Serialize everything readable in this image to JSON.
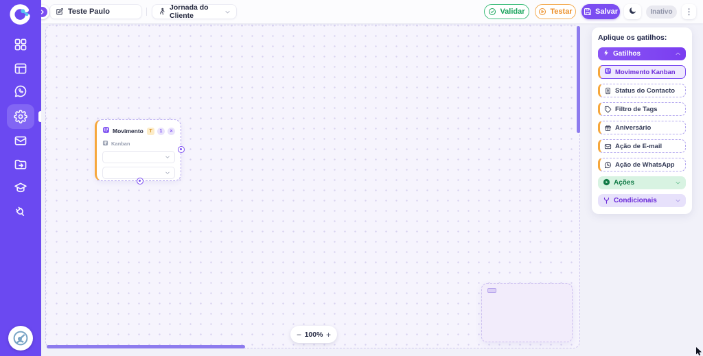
{
  "colors": {
    "sidebar": "#6b49f1",
    "accent_purple": "#7b4df1",
    "accent_orange": "#f6a73c",
    "accent_green": "#17a35b",
    "canvas_bg": "#f6f4fd"
  },
  "sidebar": {
    "icons": [
      "dashboard-icon",
      "board-icon",
      "whatsapp-icon",
      "settings-icon",
      "inbox-icon",
      "folder-import-icon",
      "education-icon",
      "integrations-icon"
    ],
    "active_icon": "settings-icon"
  },
  "header": {
    "flow_name": {
      "value": "Teste Paulo"
    },
    "journey_select": {
      "value": "Jornada do Cliente"
    },
    "validate_label": "Validar",
    "test_label": "Testar",
    "save_label": "Salvar",
    "status_label": "Inativo",
    "kebab": "⋮"
  },
  "canvas": {
    "node": {
      "title": "Movimento ...",
      "badge_type": "T",
      "badge_count": "1",
      "badge_close": "×",
      "subtitle": "Kanban"
    },
    "zoom": {
      "minus": "−",
      "level": "100%",
      "plus": "+"
    }
  },
  "right_panel": {
    "title": "Aplique os gatilhos:",
    "sections": {
      "triggers": "Gatilhos",
      "actions": "Ações",
      "conditionals": "Condicionais"
    },
    "triggers": [
      {
        "label": "Movimento Kanban",
        "icon": "kanban-icon",
        "selected": true
      },
      {
        "label": "Status do Contacto",
        "icon": "contact-icon",
        "selected": false
      },
      {
        "label": "Filtro de Tags",
        "icon": "tag-icon",
        "selected": false
      },
      {
        "label": "Aniversário",
        "icon": "gift-icon",
        "selected": false
      },
      {
        "label": "Ação de E-mail",
        "icon": "mail-icon",
        "selected": false
      },
      {
        "label": "Ação de WhatsApp",
        "icon": "whatsapp-icon",
        "selected": false
      }
    ]
  }
}
